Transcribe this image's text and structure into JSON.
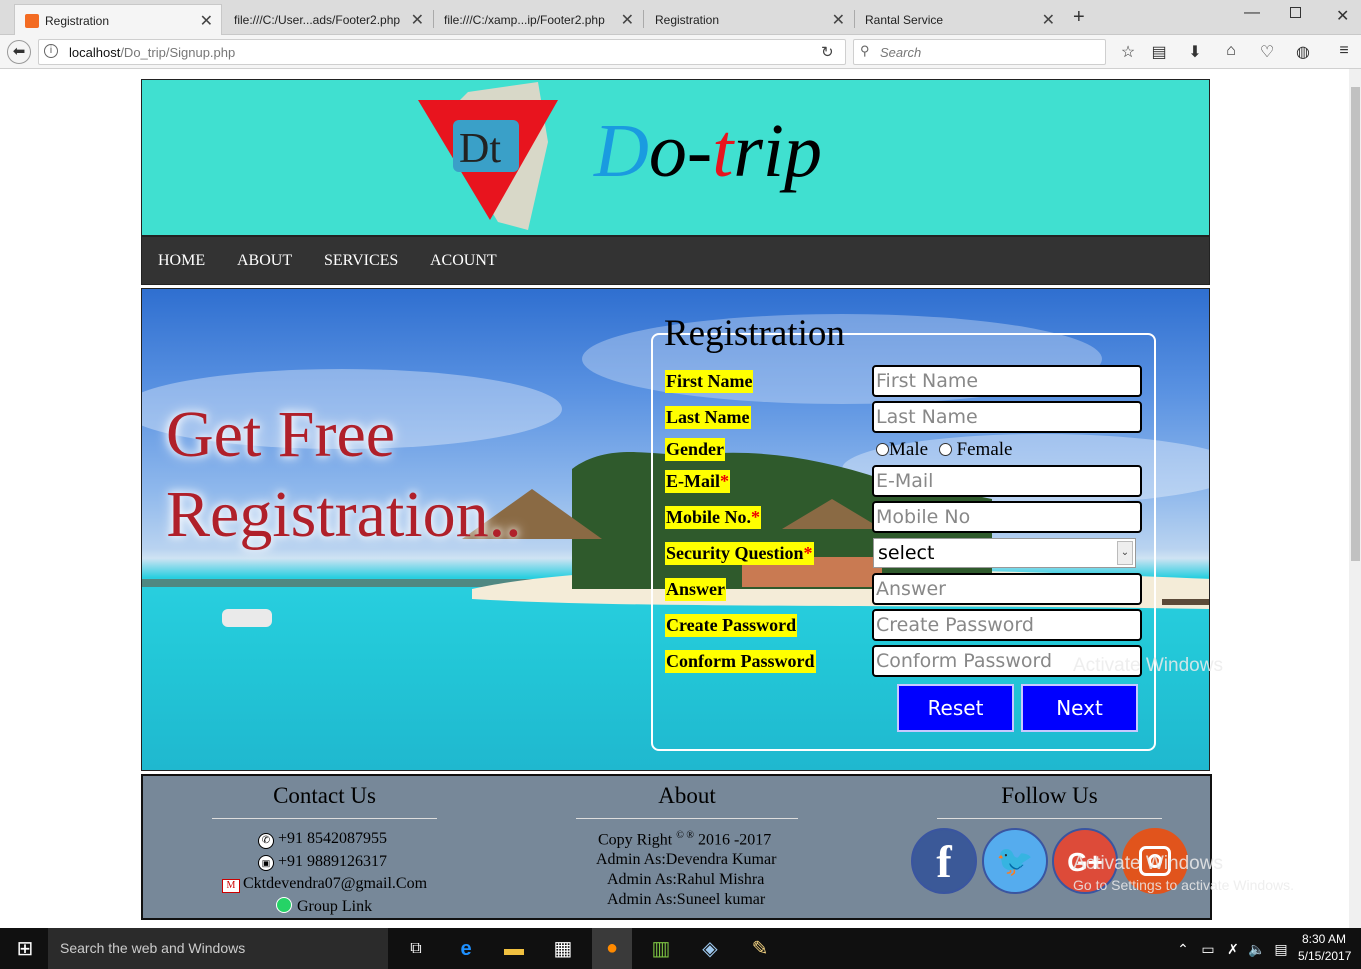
{
  "browser": {
    "tabs": [
      {
        "label": "Registration"
      },
      {
        "label": "file:///C:/User...ads/Footer2.php"
      },
      {
        "label": "file:///C:/xamp...ip/Footer2.php"
      },
      {
        "label": "Registration"
      },
      {
        "label": "Rantal Service"
      }
    ],
    "url_host": "localhost",
    "url_path": "/Do_trip/Signup.php",
    "search_placeholder": "Search"
  },
  "header": {
    "logo_text": "Dt",
    "brand_d": "D",
    "brand_o": "o-",
    "brand_t": "t",
    "brand_rip": "rip"
  },
  "menu": {
    "items": [
      "HOME",
      "ABOUT",
      "SERVICES",
      "ACOUNT"
    ]
  },
  "hero": {
    "line1": "Get Free",
    "line2": "Registration.."
  },
  "form": {
    "legend": "Registration",
    "first_name_label": "First Name",
    "first_name_placeholder": "First Name",
    "last_name_label": "Last Name",
    "last_name_placeholder": "Last Name",
    "gender_label": "Gender",
    "gender_male": "Male",
    "gender_female": "Female",
    "email_label": "E-Mail",
    "email_placeholder": "E-Mail",
    "mobile_label": "Mobile No.",
    "mobile_placeholder": "Mobile No",
    "security_label": "Security Question",
    "security_selected": "select",
    "answer_label": "Answer",
    "answer_placeholder": "Answer",
    "password_label": "Create Password",
    "password_placeholder": "Create Password",
    "confirm_label": "Conform Password",
    "confirm_placeholder": "Conform Password",
    "required_mark": "*",
    "reset_label": "Reset",
    "next_label": "Next"
  },
  "footer": {
    "contact": {
      "title": "Contact Us",
      "phone1": "+91 8542087955",
      "phone2": "+91 9889126317",
      "email": "Cktdevendra07@gmail.Com",
      "group": "Group Link"
    },
    "about": {
      "title": "About",
      "copyright_prefix": "Copy Right",
      "copyright_marks": "© ®",
      "copyright_years": "2016 -2017",
      "admin1": "Admin As:Devendra Kumar",
      "admin2": "Admin As:Rahul Mishra",
      "admin3": "Admin As:Suneel kumar"
    },
    "follow": {
      "title": "Follow Us",
      "icons": [
        "facebook-icon",
        "twitter-icon",
        "google-plus-icon",
        "instagram-icon"
      ]
    }
  },
  "watermark": {
    "line1": "Activate Windows",
    "line2": "Go to Settings to activate Windows."
  },
  "taskbar": {
    "search_placeholder": "Search the web and Windows",
    "time": "8:30 AM",
    "date": "5/15/2017"
  },
  "colors": {
    "header_bg": "#40e0d0",
    "menu_bg": "#333333",
    "label_bg": "#ffff00",
    "button_bg": "#0000ff",
    "footer_bg": "#778899",
    "hero_text": "#b0202a"
  }
}
